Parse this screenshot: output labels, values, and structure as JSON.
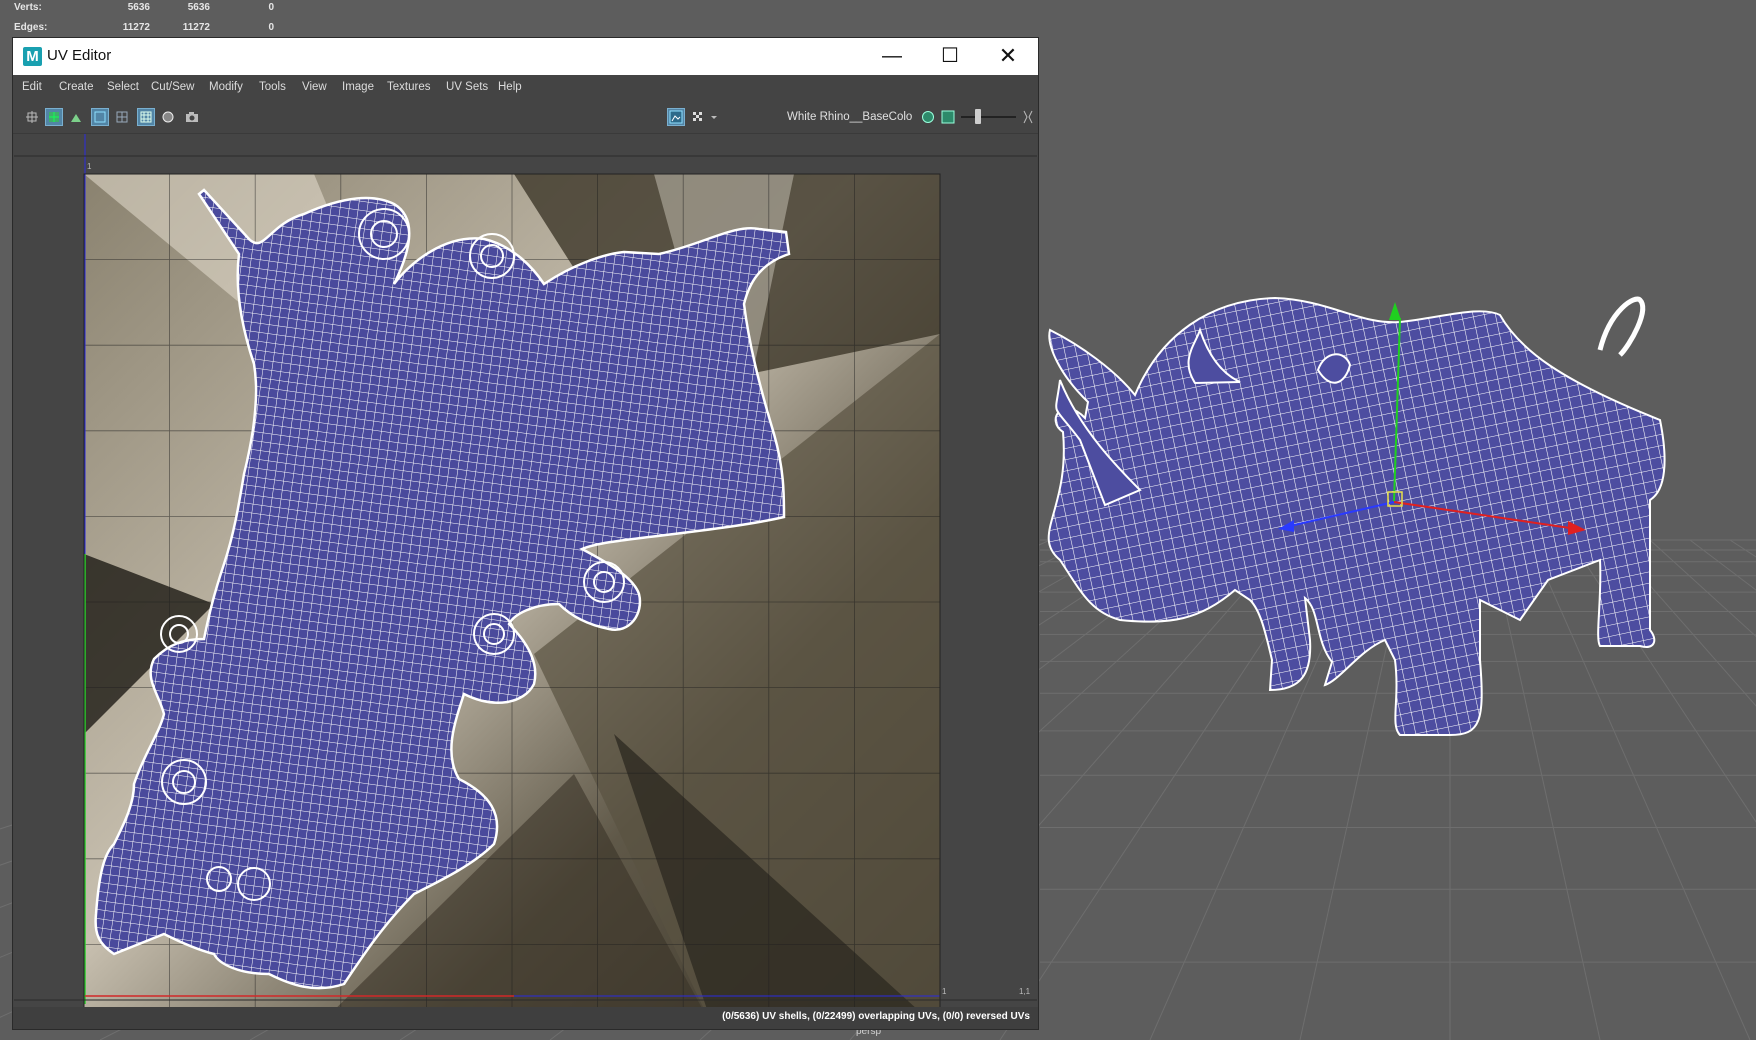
{
  "hud": {
    "rows": [
      {
        "label": "Verts:",
        "v1": "5636",
        "v2": "5636",
        "v3": "0"
      },
      {
        "label": "Edges:",
        "v1": "11272",
        "v2": "11272",
        "v3": "0"
      }
    ]
  },
  "viewport": {
    "camera_label": "persp"
  },
  "uv_editor": {
    "title": "UV Editor",
    "app_icon_letter": "M",
    "window_buttons": {
      "minimize": "—",
      "maximize": "☐",
      "close": "✕"
    },
    "menu": [
      "Edit",
      "Create",
      "Select",
      "Cut/Sew",
      "Modify",
      "Tools",
      "View",
      "Image",
      "Textures",
      "UV Sets",
      "Help"
    ],
    "toolbar": {
      "image_name": "White Rhino__BaseColor",
      "icons": [
        "uv-toggle-icon",
        "texture-tiles-icon",
        "shaded-shell-icon",
        "uv-frame-icon",
        "grid-icon",
        "grid-on-icon",
        "dim-image-icon",
        "snapshot-icon",
        "image-display-icon",
        "checker-icon",
        "image-options-icon",
        "image-file-icon",
        "bracket-icon"
      ]
    },
    "ruler_labels": {
      "top_left": "1",
      "top_right": "1",
      "bottom_right": "1,1"
    },
    "status": "(0/5636) UV shells, (0/22499) overlapping UVs, (0/0) reversed UVs"
  },
  "colors": {
    "uv_mesh_fill": "#4a4a9c",
    "wire": "#ffffff",
    "viewport_bg": "#5d5d5d",
    "u_axis": "#d22828",
    "v_axis": "#28c828",
    "manip_x": "#e02020",
    "manip_y": "#20d020",
    "manip_z": "#2a3aff"
  }
}
